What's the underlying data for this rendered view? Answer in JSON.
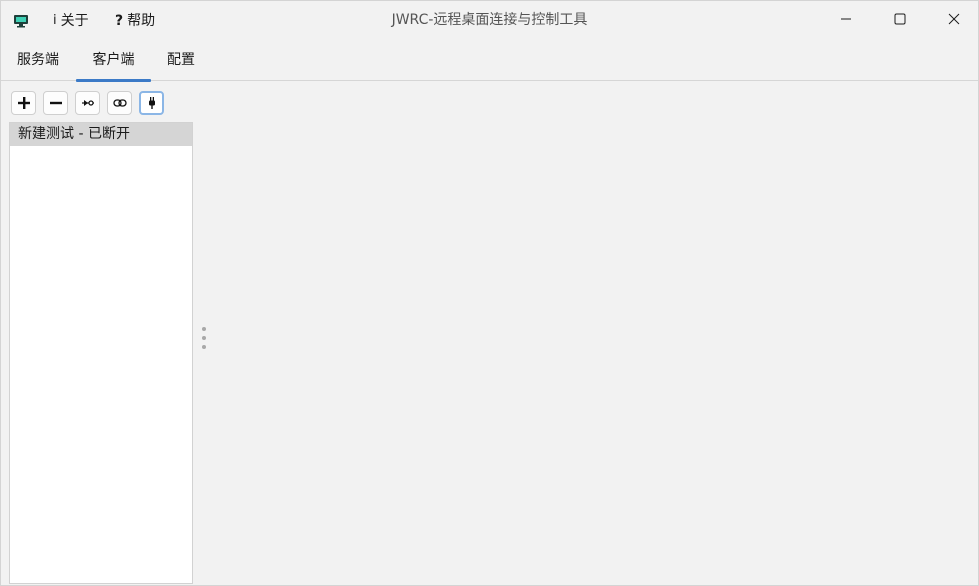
{
  "window": {
    "title": "JWRC-远程桌面连接与控制工具"
  },
  "menu": {
    "about": {
      "glyph": "i",
      "label": "关于"
    },
    "help": {
      "glyph": "?",
      "label": "帮助"
    }
  },
  "tabs": [
    {
      "label": "服务端"
    },
    {
      "label": "客户端"
    },
    {
      "label": "配置"
    }
  ],
  "active_tab": "客户端",
  "toolbar": [
    {
      "icon": "plus-icon"
    },
    {
      "icon": "minus-icon"
    },
    {
      "icon": "connect-arrow-icon"
    },
    {
      "icon": "link-icon"
    },
    {
      "icon": "plug-icon"
    }
  ],
  "sessions": [
    {
      "label": "新建测试 - 已断开"
    }
  ],
  "colors": {
    "accent": "#3b7ac7",
    "selected_row": "#d5d5d5",
    "background": "#f2f2f2"
  }
}
